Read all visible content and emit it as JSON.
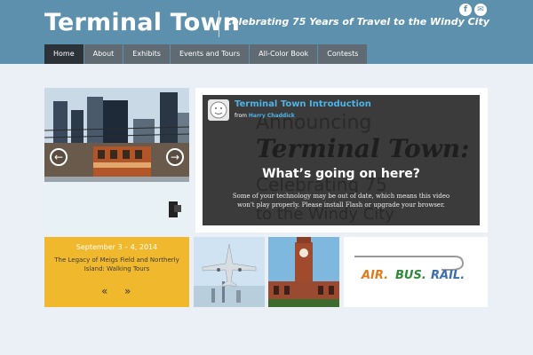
{
  "site": {
    "title": "Terminal Town",
    "tagline": "Celebrating 75 Years of Travel to the Windy City",
    "social": [
      {
        "icon": "facebook-icon",
        "glyph": "f"
      },
      {
        "icon": "email-icon",
        "glyph": "✉"
      }
    ]
  },
  "nav": {
    "items": [
      {
        "label": "Home",
        "active": true
      },
      {
        "label": "About",
        "active": false
      },
      {
        "label": "Exhibits",
        "active": false
      },
      {
        "label": "Events and Tours",
        "active": false
      },
      {
        "label": "All-Color Book",
        "active": false
      },
      {
        "label": "Contests",
        "active": false
      }
    ]
  },
  "slider": {
    "prev_glyph": "←",
    "next_glyph": "→"
  },
  "video": {
    "title": "Terminal Town Introduction",
    "from_label": "from",
    "author": "Harry Chaddick",
    "heading": "What’s going on here?",
    "message": "Some of your technology may be out of date, which means this video won't play properly. Please install Flash or upgrade your browser.",
    "bg_text": [
      "Announcing",
      "Terminal Town:",
      "Celebrating 75",
      "to the Windy City"
    ]
  },
  "event": {
    "date": "September 3 – 4, 2014",
    "title": "The Legacy of Meigs Field and Northerly Island: Walking Tours",
    "prev_glyph": "«",
    "next_glyph": "»"
  },
  "logo": {
    "words": [
      "AIR.",
      "BUS.",
      "RAIL."
    ]
  },
  "colors": {
    "header_bg": "#5d90ac",
    "nav_active": "#2c3338",
    "nav_item": "#5f6a72",
    "event_card": "#f0b92d",
    "link_blue": "#4fb3e8",
    "logo_air": "#e07a1a",
    "logo_bus": "#2f8a3a",
    "logo_rail": "#3a6fb0"
  }
}
